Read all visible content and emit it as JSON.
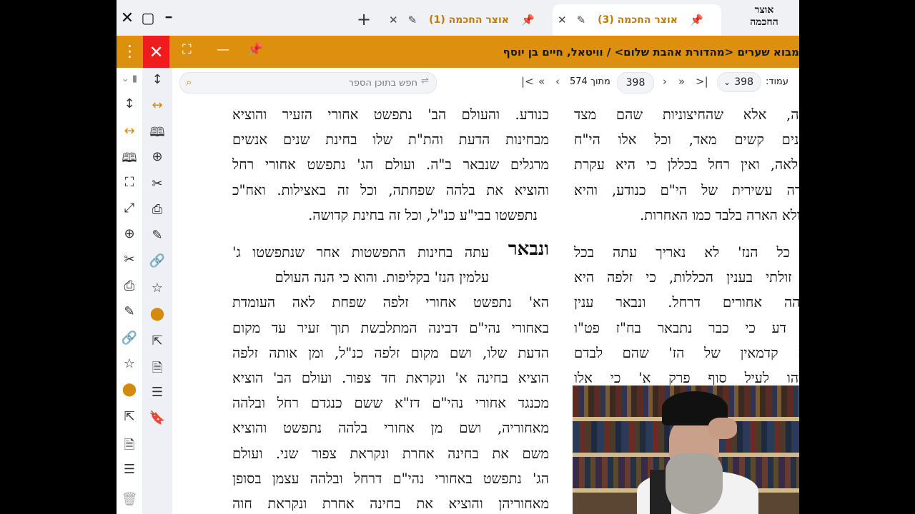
{
  "window": {
    "close_glyph": "✕",
    "restore_glyph": "▢",
    "minimize_glyph": "━"
  },
  "logo": {
    "line1": "אוצר",
    "line2": "החכמה"
  },
  "tabs": [
    {
      "label": "אוצר החכמה (3)",
      "active": true
    },
    {
      "label": "אוצר החכמה (1)",
      "active": false
    }
  ],
  "titlebar": {
    "book_title": "מבוא שערים <מהדורת אהבת שלום> / וויטאל, חיים בן יוסף"
  },
  "nav": {
    "page_label": "עמוד:",
    "page_value": "398",
    "current": "398",
    "of_label": "מתוך 574",
    "search_placeholder": "חפש בתוכן הספר"
  },
  "colors": {
    "accent": "#dc900e",
    "close_red": "#ee1c1c",
    "orange_icon": "#d4890f"
  },
  "icons": {
    "left_sidebar": [
      "vertical-arrows-icon",
      "horizontal-arrows-icon",
      "open-book-icon",
      "fullscreen-icon",
      "expand-icon",
      "zoom-in-icon",
      "crop-icon",
      "print-icon",
      "edit-icon",
      "link-icon",
      "star-icon",
      "location-pin-icon",
      "external-link-icon",
      "document-info-icon",
      "list-icon",
      "delete-icon"
    ],
    "right_sidebar": [
      "vertical-arrows-icon",
      "horizontal-arrows-icon",
      "open-book-icon",
      "zoom-in-icon",
      "crop-icon",
      "print-icon",
      "edit-icon",
      "link-icon",
      "star-icon",
      "location-pin-icon",
      "external-link-icon",
      "document-info-icon",
      "list-icon",
      "bookmark-icon"
    ]
  },
  "text": {
    "col_right": [
      "אשה, אלא שהחיצוניות שהם מצד",
      "הדינים קשים מאד, וכל אלו הי\"ח",
      "ת לאה, ואין רחל בכללן כי היא עקרת",
      "נקודה עשירית של הי\"ם כנודע, והיא",
      "ות ולא הארה בלבד כמו האחרות.",
      "",
      "ת כל הנז' לא נאריך עתה בכל",
      "ים זולתי בענין הכללות, כי זלפה היא",
      "ובלהה אחורים דרחל. ונבאר ענין",
      "לו. דע כי כבר נתבאר בח\"ז פט\"ו",
      "כים קדמאין של הז' שהם לבדם",
      "ורנוהו לעיל סוף פרק א' כי אלו"
    ],
    "col_left": [
      "כנודע. והעולם הב' נתפשט אחורי הזעיר והוציא",
      "מבחינות הדעת והת\"ת שלו בחינת שנים אנשים",
      "מרגלים שנבאר ב\"ה. ועולם הג' נתפשט אחורי רחל",
      "והוציא את בלהה שפחתה, וכל זה באצילות. ואח\"כ",
      "נתפשטו בבי\"ע כנ\"ל, וכל זה בחינת קדושה.",
      "",
      "עתה בחינות התפשטות אחר שנתפשטו ג'",
      "עלמין הנז' בקליפות. והוא כי הנה העולם",
      "הא' נתפשט אחורי זלפה שפחת לאה העומדת",
      "באחורי נהי\"ם דבינה המתלבשת תוך זעיר עד מקום",
      "הדעת שלו, ושם מקום זלפה כנ\"ל, ומן אותה זלפה",
      "הוציא בחינה א' ונקראת חד צפור. ועולם הב' הוציא",
      "מכנגד אחורי נהי\"ם דז\"א ששם כנגדם רחל ובלהה",
      "מאחוריה, ושם מן אחורי בלהה נתפשט והוציא",
      "משם את בחינה אחרת ונקראת צפור שני. ועולם",
      "הג' נתפשט באחורי נהי\"ם דרחל ובלהה עצמן בסופן",
      "מאחוריהן והוציא את בחינה אחרת ונקראת חוה"
    ],
    "big_word": "ונבאר"
  }
}
